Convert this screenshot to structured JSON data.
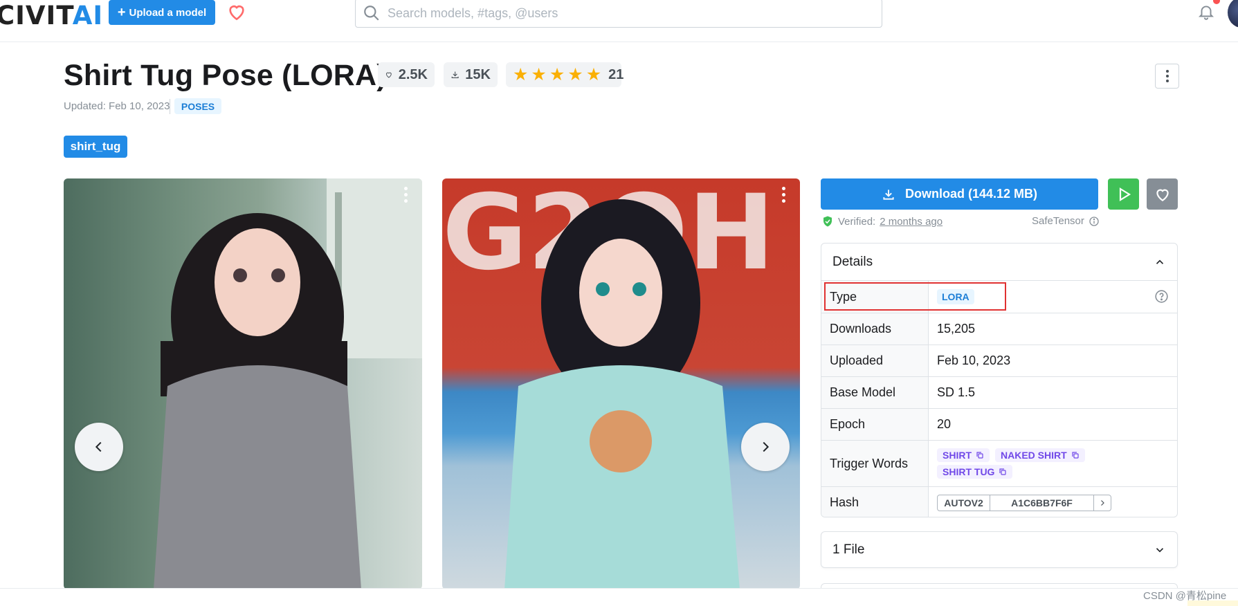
{
  "header": {
    "logo_text_dark": "CIVIT",
    "logo_text_accent": "AI",
    "upload_label": "Upload a model",
    "search_placeholder": "Search models, #tags, @users",
    "icons": [
      "heart-icon",
      "search-icon",
      "bell-icon",
      "avatar"
    ]
  },
  "model": {
    "title": "Shirt Tug Pose (LORA)",
    "likes": "2.5K",
    "downloads": "15K",
    "rating_stars": 5,
    "rating_count": "21",
    "updated": "Updated: Feb 10, 2023",
    "category": "POSES",
    "tag": "shirt_tug"
  },
  "actions": {
    "download_label": "Download (144.12 MB)",
    "verified_prefix": "Verified:",
    "verified_when": "2 months ago",
    "file_format": "SafeTensor"
  },
  "details": {
    "title": "Details",
    "rows": {
      "type": {
        "label": "Type",
        "value": "LORA"
      },
      "downloads": {
        "label": "Downloads",
        "value": "15,205"
      },
      "uploaded": {
        "label": "Uploaded",
        "value": "Feb 10, 2023"
      },
      "base_model": {
        "label": "Base Model",
        "value": "SD 1.5"
      },
      "epoch": {
        "label": "Epoch",
        "value": "20"
      },
      "trigger_words": {
        "label": "Trigger Words",
        "values": [
          "SHIRT",
          "NAKED SHIRT",
          "SHIRT TUG"
        ]
      },
      "hash": {
        "label": "Hash",
        "type": "AUTOV2",
        "value": "A1C6BB7F6F"
      }
    }
  },
  "files": {
    "title": "1 File"
  },
  "watermark": "CSDN @青松pine",
  "colors": {
    "primary": "#228be6",
    "success": "#40c057",
    "highlight": "#e03131",
    "star": "#fab005"
  }
}
